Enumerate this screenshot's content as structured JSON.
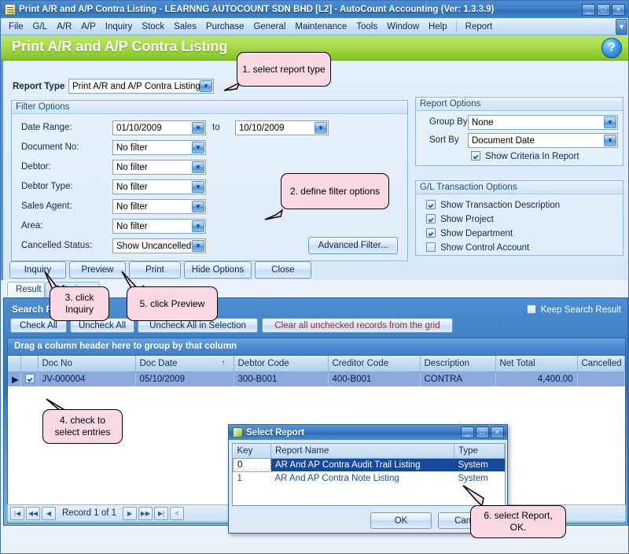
{
  "window": {
    "title": "Print A/R and A/P Contra Listing - LEARNNG AUTOCOUNT SDN BHD [L2] - AutoCount Accounting (Ver: 1.3.3.9)",
    "icon": "document-icon",
    "minimize": "_",
    "maximize": "□",
    "close": "×"
  },
  "menu": {
    "items": [
      "File",
      "G/L",
      "A/R",
      "A/P",
      "Inquiry",
      "Stock",
      "Sales",
      "Purchase",
      "General",
      "Maintenance",
      "Tools",
      "Window",
      "Help"
    ],
    "extra": "Report",
    "overflow": "▼"
  },
  "header": {
    "title": "Print A/R and A/P Contra Listing",
    "help": "?"
  },
  "report_type": {
    "label": "Report Type",
    "value": "Print A/R and A/P Contra Listing"
  },
  "filter_options": {
    "title": "Filter Options",
    "date_range_label": "Date Range:",
    "date_from": "01/10/2009",
    "date_to_label": "to",
    "date_to": "10/10/2009",
    "rows": [
      {
        "label": "Document No:",
        "value": "No filter"
      },
      {
        "label": "Debtor:",
        "value": "No filter"
      },
      {
        "label": "Debtor Type:",
        "value": "No filter"
      },
      {
        "label": "Sales Agent:",
        "value": "No filter"
      },
      {
        "label": "Area:",
        "value": "No filter"
      },
      {
        "label": "Cancelled Status:",
        "value": "Show Uncancelled"
      }
    ],
    "advanced_filter": "Advanced Filter..."
  },
  "report_options": {
    "title": "Report Options",
    "group_by_label": "Group By",
    "group_by_value": "None",
    "sort_by_label": "Sort By",
    "sort_by_value": "Document Date",
    "show_criteria_label": "Show Criteria In Report",
    "show_criteria_checked": true
  },
  "gl_options": {
    "title": "G/L Transaction Options",
    "items": [
      {
        "label": "Show Transaction Description",
        "checked": true
      },
      {
        "label": "Show Project",
        "checked": true
      },
      {
        "label": "Show Department",
        "checked": true
      },
      {
        "label": "Show Control Account",
        "checked": false
      }
    ]
  },
  "action_buttons": [
    "Inquiry",
    "Preview",
    "Print",
    "Hide Options",
    "Close"
  ],
  "tabs": [
    {
      "label": "Result",
      "active": true
    },
    {
      "label": "Criteria",
      "active": false
    }
  ],
  "search_result": {
    "title": "Search Result",
    "keep_label": "Keep Search Result",
    "keep_checked": false,
    "buttons": [
      "Check All",
      "Uncheck All",
      "Uncheck All in Selection"
    ],
    "clear_button": "Clear all unchecked records from the grid",
    "clear_button_color": "#9e2b2b",
    "group_band": "Drag a column header here to group by that column",
    "columns": [
      "Doc No",
      "Doc Date",
      "Debtor Code",
      "Creditor Code",
      "Description",
      "Net Total",
      "Cancelled"
    ],
    "sort_column": "Doc Date",
    "sort_arrow": "↑",
    "rows": [
      {
        "indicator": "▶",
        "checked": true,
        "doc_no": "JV-000004",
        "doc_date": "05/10/2009",
        "debtor_code": "300-B001",
        "creditor_code": "400-B001",
        "description": "CONTRA",
        "net_total": "4,400.00",
        "cancelled": ""
      }
    ]
  },
  "navigator": {
    "first": "|◀",
    "prev_page": "◀◀",
    "prev": "◀",
    "text": "Record 1 of 1",
    "next": "▶",
    "next_page": "▶▶",
    "last": "▶|",
    "extra": "<"
  },
  "dialog": {
    "title": "Select Report",
    "icon": "report-icon",
    "minimize": "_",
    "maximize": "□",
    "close": "×",
    "columns": [
      "Key",
      "Report Name",
      "Type"
    ],
    "rows": [
      {
        "key": "0",
        "name": "AR And AP Contra Audit Trail Listing",
        "type": "System",
        "selected": true
      },
      {
        "key": "1",
        "name": "AR And AP Contra Note Listing",
        "type": "System",
        "selected": false
      }
    ],
    "ok": "OK",
    "cancel": "Cancel"
  },
  "callouts": [
    {
      "id": "c1",
      "text": "1. select report type"
    },
    {
      "id": "c2",
      "text": "2. define filter options"
    },
    {
      "id": "c3",
      "text": "3. click Inquiry"
    },
    {
      "id": "c4",
      "text": "4. check to select entries"
    },
    {
      "id": "c5",
      "text": "5. click Preview"
    },
    {
      "id": "c6",
      "text": "6. select Report, OK."
    }
  ],
  "colors": {
    "accent_green": "#93cf33",
    "title_blue": "#3d7fc8",
    "callout_pink": "#fbd9e3",
    "grid_selected": "#8ca9dd",
    "dialog_selected": "#16499c"
  }
}
